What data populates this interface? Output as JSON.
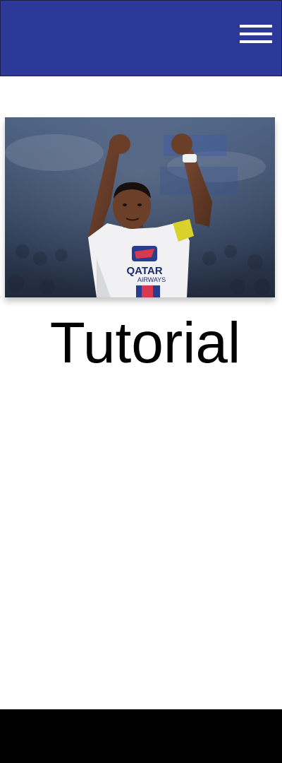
{
  "header": {
    "background_color": "#2c3999",
    "menu_icon": "hamburger-menu-icon"
  },
  "hero": {
    "image_subject": "celebrating football player"
  },
  "main": {
    "title": "Tutorial"
  },
  "footer": {
    "background_color": "#000000"
  }
}
